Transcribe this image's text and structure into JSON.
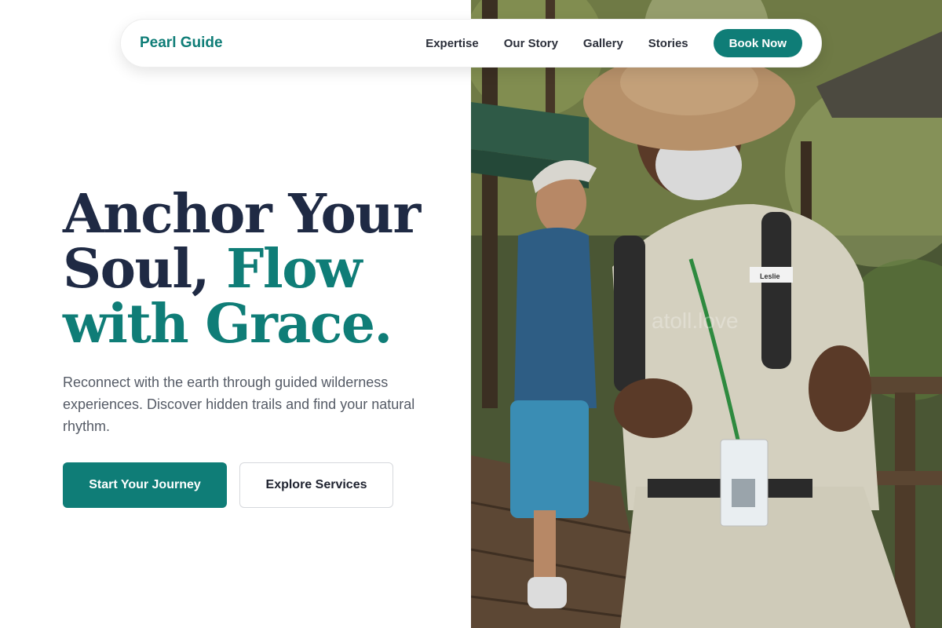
{
  "nav": {
    "brand": "Pearl Guide",
    "links": [
      "Expertise",
      "Our Story",
      "Gallery",
      "Stories"
    ],
    "cta": "Book Now"
  },
  "hero": {
    "title_line1": "Anchor Your",
    "title_line2_dark": "Soul, ",
    "title_line2_accent": "Flow",
    "title_line3_accent": "with Grace.",
    "subtitle": "Reconnect with the earth through guided wilderness experiences. Discover hidden trails and find your natural rhythm.",
    "primary_cta": "Start Your Journey",
    "secondary_cta": "Explore Services"
  },
  "photo": {
    "watermark": "atoll.love",
    "badge_name": "Leslie"
  },
  "colors": {
    "brand": "#0f7d77",
    "heading": "#1f2a44",
    "body_text": "#555b66"
  }
}
